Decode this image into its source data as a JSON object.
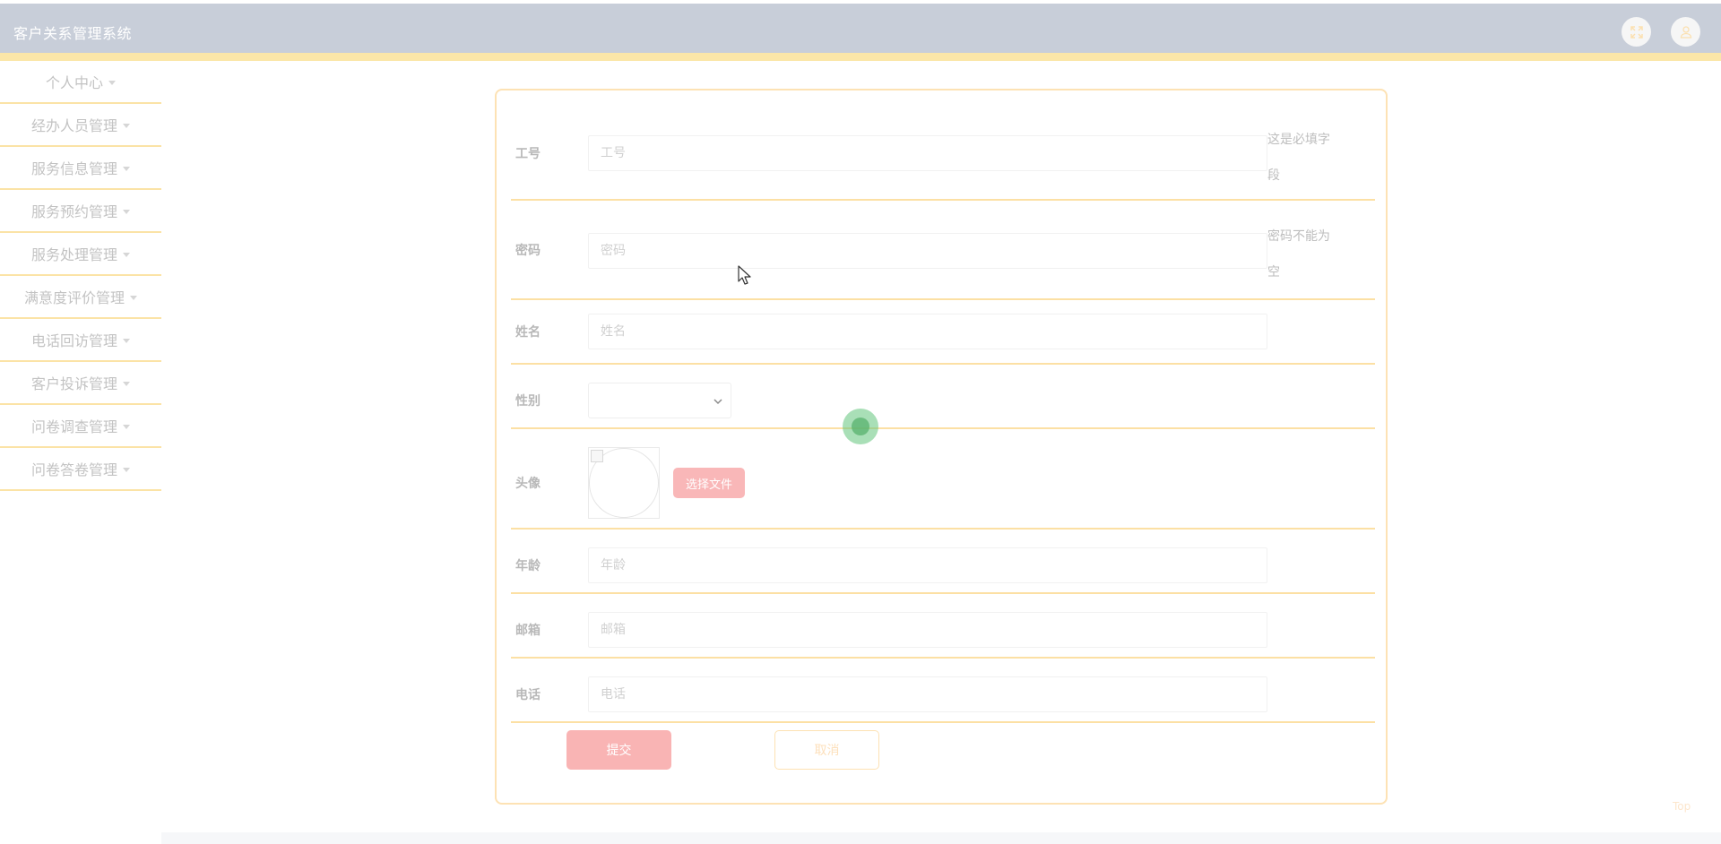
{
  "header": {
    "title": "客户关系管理系统",
    "fullscreen_icon": "fullscreen-icon",
    "user_icon": "user-icon"
  },
  "sidebar": {
    "items": [
      {
        "label": "个人中心"
      },
      {
        "label": "经办人员管理"
      },
      {
        "label": "服务信息管理"
      },
      {
        "label": "服务预约管理"
      },
      {
        "label": "服务处理管理"
      },
      {
        "label": "满意度评价管理"
      },
      {
        "label": "电话回访管理"
      },
      {
        "label": "客户投诉管理"
      },
      {
        "label": "问卷调查管理"
      },
      {
        "label": "问卷答卷管理"
      }
    ]
  },
  "form": {
    "fields": {
      "employee_id": {
        "label": "工号",
        "placeholder": "工号",
        "value": "",
        "hint_line1": "这是必填字",
        "hint_line2": "段"
      },
      "password": {
        "label": "密码",
        "placeholder": "密码",
        "value": "",
        "hint_line1": "密码不能为",
        "hint_line2": "空"
      },
      "name": {
        "label": "姓名",
        "placeholder": "姓名",
        "value": ""
      },
      "gender": {
        "label": "性别",
        "value": ""
      },
      "avatar": {
        "label": "头像",
        "button_label": "选择文件"
      },
      "age": {
        "label": "年龄",
        "placeholder": "年龄",
        "value": ""
      },
      "email": {
        "label": "邮箱",
        "placeholder": "邮箱",
        "value": ""
      },
      "phone": {
        "label": "电话",
        "placeholder": "电话",
        "value": ""
      }
    },
    "submit_label": "提交",
    "cancel_label": "取消"
  },
  "footer": {
    "top_link": "Top"
  },
  "colors": {
    "header_bg": "#c8ced9",
    "accent_strip": "#fbe6a8",
    "submit_bg": "#f9b4b4",
    "card_border": "#fde2b4"
  }
}
